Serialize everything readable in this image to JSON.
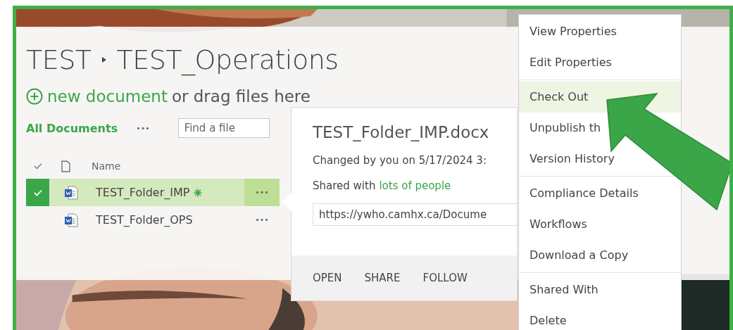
{
  "breadcrumb": [
    {
      "label": "TEST"
    },
    {
      "label": "TEST_Operations"
    }
  ],
  "new_document": {
    "link": "new document",
    "text": "or drag files here"
  },
  "toolbar": {
    "view": "All Documents",
    "more": "•••",
    "search": {
      "placeholder": "Find a file"
    }
  },
  "table": {
    "columns": [
      "Name"
    ],
    "rows": [
      {
        "name": "TEST_Folder_IMP",
        "selected": true,
        "is_new": true,
        "more": "•••"
      },
      {
        "name": "TEST_Folder_OPS",
        "selected": false,
        "is_new": false,
        "more": "•••"
      }
    ]
  },
  "callout": {
    "title": "TEST_Folder_IMP.docx",
    "changed": "Changed by you on 5/17/2024 3:",
    "shared_prefix": "Shared with",
    "shared_link": "lots of people",
    "url": "https://ywho.camhx.ca/Docume",
    "actions": [
      "OPEN",
      "SHARE",
      "FOLLOW"
    ]
  },
  "menu": {
    "groups": [
      [
        {
          "label": "View Properties",
          "selected": false
        },
        {
          "label": "Edit Properties",
          "selected": false
        }
      ],
      [
        {
          "label": "Check Out",
          "selected": true
        },
        {
          "label": "Unpublish th",
          "selected": false
        },
        {
          "label": "Version History",
          "selected": false
        }
      ],
      [
        {
          "label": "Compliance Details",
          "selected": false
        },
        {
          "label": "Workflows",
          "selected": false
        },
        {
          "label": "Download a Copy",
          "selected": false
        }
      ],
      [
        {
          "label": "Shared With",
          "selected": false
        },
        {
          "label": "Delete",
          "selected": false
        }
      ]
    ]
  }
}
